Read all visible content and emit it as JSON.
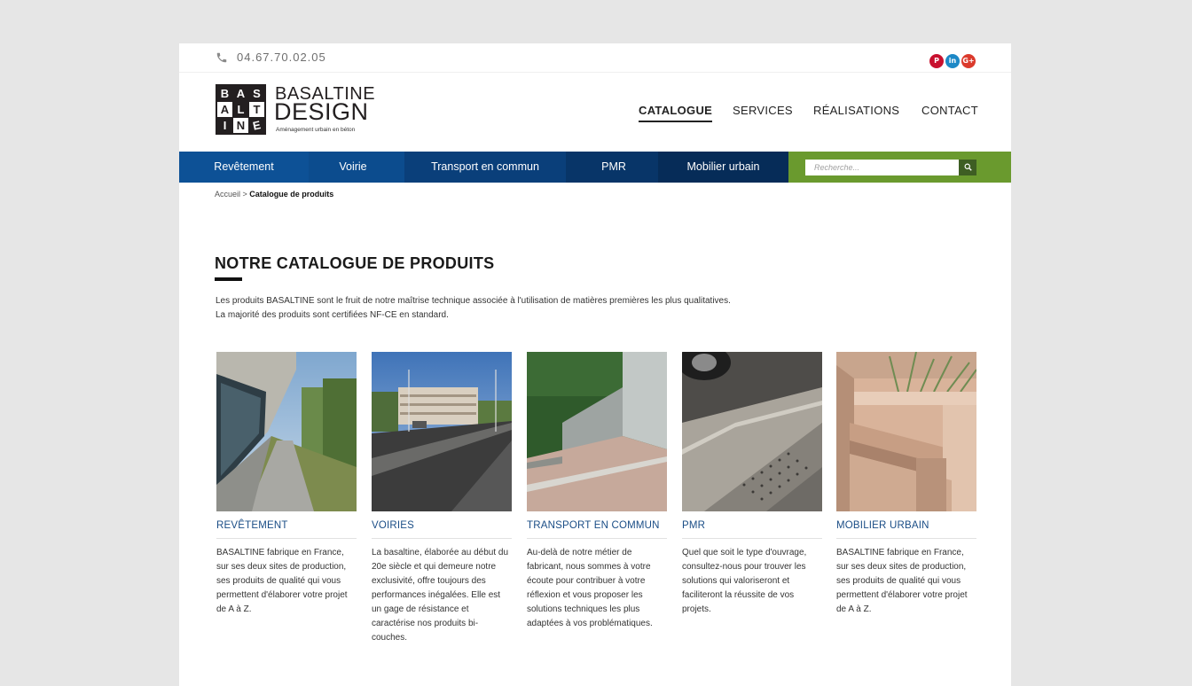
{
  "topbar": {
    "phone": "04.67.70.02.05"
  },
  "social": [
    "pinterest-icon",
    "linkedin-icon",
    "google-plus-icon"
  ],
  "logo": {
    "letters": [
      "B",
      "A",
      "S",
      "A",
      "L",
      "T",
      "I",
      "N",
      "E"
    ],
    "title1": "BASALTINE",
    "title2": "DESIGN",
    "tagline": "Aménagement urbain en béton"
  },
  "nav": [
    {
      "label": "CATALOGUE",
      "active": true
    },
    {
      "label": "SERVICES"
    },
    {
      "label": "RÉALISATIONS"
    },
    {
      "label": "CONTACT"
    }
  ],
  "categories": [
    {
      "label": "Revêtement",
      "color": "#0d5196"
    },
    {
      "label": "Voirie",
      "color": "#0c4c8e"
    },
    {
      "label": "Transport en commun",
      "color": "#0a3f7a"
    },
    {
      "label": "PMR",
      "color": "#083568"
    },
    {
      "label": "Mobilier urbain",
      "color": "#062c58"
    }
  ],
  "search": {
    "placeholder": "Recherche..."
  },
  "breadcrumb": {
    "home": "Accueil",
    "separator": " > ",
    "current": "Catalogue de produits"
  },
  "main": {
    "title": "NOTRE CATALOGUE DE PRODUITS",
    "intro_line1": "Les produits BASALTINE sont le fruit de notre maîtrise technique associée à l'utilisation de matières premières les plus qualitatives.",
    "intro_line2": "La majorité des produits sont certifiées NF-CE en standard."
  },
  "products": [
    {
      "title": "REVÊTEMENT",
      "desc": "BASALTINE fabrique en France, sur ses deux sites de production, ses produits de qualité qui vous permettent d'élaborer votre projet de A à Z."
    },
    {
      "title": "VOIRIES",
      "desc": "La basaltine, élaborée au début du 20e siècle et qui demeure notre exclusivité, offre toujours des performances inégalées. Elle est un gage de résistance et caractérise nos produits bi-couches."
    },
    {
      "title": "TRANSPORT EN COMMUN",
      "desc": "Au-delà de notre métier de fabricant, nous sommes à votre écoute pour contribuer à votre réflexion et vous proposer les solutions techniques les plus adaptées à vos problématiques."
    },
    {
      "title": "PMR",
      "desc": "Quel que soit le type d'ouvrage, consultez-nous pour trouver les solutions qui valoriseront et faciliteront la réussite de vos projets."
    },
    {
      "title": "MOBILIER URBAIN",
      "desc": "BASALTINE fabrique en France, sur ses deux sites de production, ses produits de qualité qui vous permettent d'élaborer votre projet de A à Z."
    }
  ]
}
